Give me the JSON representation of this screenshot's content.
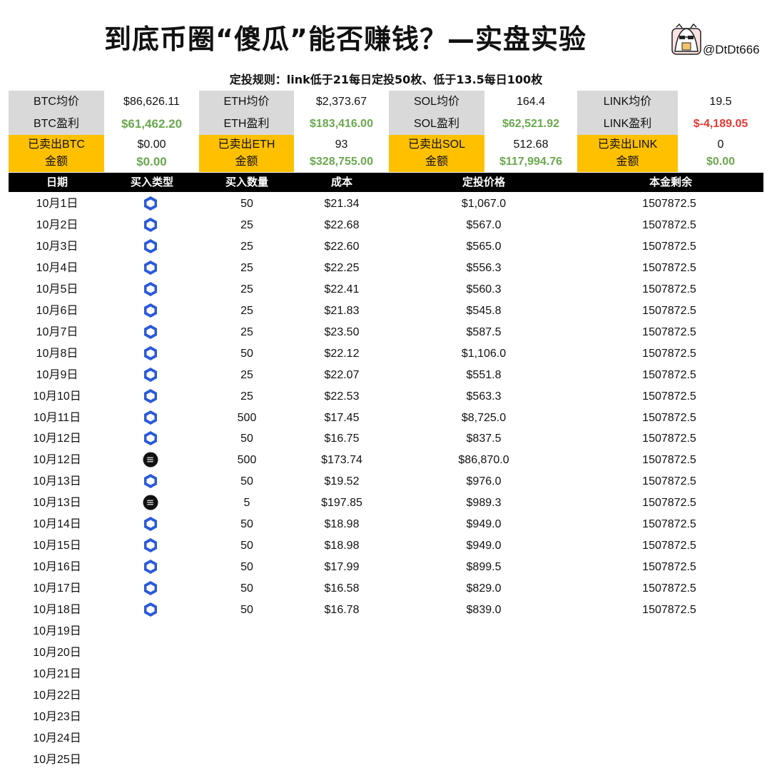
{
  "title": "到底币圈“傻瓜”能否赚钱？—实盘实验",
  "author_handle": "@DtDt666",
  "rule": "定投规则：link低于21每日定投50枚、低于13.5每日100枚",
  "summary": {
    "coins": [
      {
        "avg_label": "BTC均价",
        "avg_value": "$86,626.11",
        "profit_label": "BTC盈利",
        "profit_value": "$61,462.20",
        "profit_positive": true,
        "sold_label_1": "已卖出BTC",
        "sold_label_2": "金额",
        "sold_qty": "$0.00",
        "sold_amount": "$0.00"
      },
      {
        "avg_label": "ETH均价",
        "avg_value": "$2,373.67",
        "profit_label": "ETH盈利",
        "profit_value": "$183,416.00",
        "profit_positive": true,
        "sold_label_1": "已卖出ETH",
        "sold_label_2": "金额",
        "sold_qty": "93",
        "sold_amount": "$328,755.00"
      },
      {
        "avg_label": "SOL均价",
        "avg_value": "164.4",
        "profit_label": "SOL盈利",
        "profit_value": "$62,521.92",
        "profit_positive": true,
        "sold_label_1": "已卖出SOL",
        "sold_label_2": "金额",
        "sold_qty": "512.68",
        "sold_amount": "$117,994.76"
      },
      {
        "avg_label": "LINK均价",
        "avg_value": "19.5",
        "profit_label": "LINK盈利",
        "profit_value": "$-4,189.05",
        "profit_positive": false,
        "sold_label_1": "已卖出LINK",
        "sold_label_2": "金额",
        "sold_qty": "0",
        "sold_amount": "$0.00"
      }
    ]
  },
  "table": {
    "headers": [
      "日期",
      "买入类型",
      "买入数量",
      "成本",
      "定投价格",
      "本金剩余"
    ],
    "rows": [
      {
        "date": "10月1日",
        "coin": "link-icon",
        "qty": "50",
        "cost": "$21.34",
        "invest": "$1,067.0",
        "remaining": "1507872.5"
      },
      {
        "date": "10月2日",
        "coin": "link-icon",
        "qty": "25",
        "cost": "$22.68",
        "invest": "$567.0",
        "remaining": "1507872.5"
      },
      {
        "date": "10月3日",
        "coin": "link-icon",
        "qty": "25",
        "cost": "$22.60",
        "invest": "$565.0",
        "remaining": "1507872.5"
      },
      {
        "date": "10月4日",
        "coin": "link-icon",
        "qty": "25",
        "cost": "$22.25",
        "invest": "$556.3",
        "remaining": "1507872.5"
      },
      {
        "date": "10月5日",
        "coin": "link-icon",
        "qty": "25",
        "cost": "$22.41",
        "invest": "$560.3",
        "remaining": "1507872.5"
      },
      {
        "date": "10月6日",
        "coin": "link-icon",
        "qty": "25",
        "cost": "$21.83",
        "invest": "$545.8",
        "remaining": "1507872.5"
      },
      {
        "date": "10月7日",
        "coin": "link-icon",
        "qty": "25",
        "cost": "$23.50",
        "invest": "$587.5",
        "remaining": "1507872.5"
      },
      {
        "date": "10月8日",
        "coin": "link-icon",
        "qty": "50",
        "cost": "$22.12",
        "invest": "$1,106.0",
        "remaining": "1507872.5"
      },
      {
        "date": "10月9日",
        "coin": "link-icon",
        "qty": "25",
        "cost": "$22.07",
        "invest": "$551.8",
        "remaining": "1507872.5"
      },
      {
        "date": "10月10日",
        "coin": "link-icon",
        "qty": "25",
        "cost": "$22.53",
        "invest": "$563.3",
        "remaining": "1507872.5"
      },
      {
        "date": "10月11日",
        "coin": "link-icon",
        "qty": "500",
        "cost": "$17.45",
        "invest": "$8,725.0",
        "remaining": "1507872.5"
      },
      {
        "date": "10月12日",
        "coin": "link-icon",
        "qty": "50",
        "cost": "$16.75",
        "invest": "$837.5",
        "remaining": "1507872.5"
      },
      {
        "date": "10月12日",
        "coin": "sol-icon",
        "qty": "500",
        "cost": "$173.74",
        "invest": "$86,870.0",
        "remaining": "1507872.5"
      },
      {
        "date": "10月13日",
        "coin": "link-icon",
        "qty": "50",
        "cost": "$19.52",
        "invest": "$976.0",
        "remaining": "1507872.5"
      },
      {
        "date": "10月13日",
        "coin": "sol-icon",
        "qty": "5",
        "cost": "$197.85",
        "invest": "$989.3",
        "remaining": "1507872.5"
      },
      {
        "date": "10月14日",
        "coin": "link-icon",
        "qty": "50",
        "cost": "$18.98",
        "invest": "$949.0",
        "remaining": "1507872.5"
      },
      {
        "date": "10月15日",
        "coin": "link-icon",
        "qty": "50",
        "cost": "$18.98",
        "invest": "$949.0",
        "remaining": "1507872.5"
      },
      {
        "date": "10月16日",
        "coin": "link-icon",
        "qty": "50",
        "cost": "$17.99",
        "invest": "$899.5",
        "remaining": "1507872.5"
      },
      {
        "date": "10月17日",
        "coin": "link-icon",
        "qty": "50",
        "cost": "$16.58",
        "invest": "$829.0",
        "remaining": "1507872.5"
      },
      {
        "date": "10月18日",
        "coin": "link-icon",
        "qty": "50",
        "cost": "$16.78",
        "invest": "$839.0",
        "remaining": "1507872.5"
      },
      {
        "date": "10月19日"
      },
      {
        "date": "10月20日"
      },
      {
        "date": "10月21日"
      },
      {
        "date": "10月22日"
      },
      {
        "date": "10月23日"
      },
      {
        "date": "10月24日"
      },
      {
        "date": "10月25日"
      }
    ]
  },
  "colors": {
    "label_bg": "#d9d9d9",
    "sold_bg": "#ffc000",
    "header_bg": "#000000",
    "profit_positive": "#6aa84f",
    "profit_negative": "#e53935",
    "link_blue": "#2a5ada",
    "sol_dark": "#111111"
  }
}
